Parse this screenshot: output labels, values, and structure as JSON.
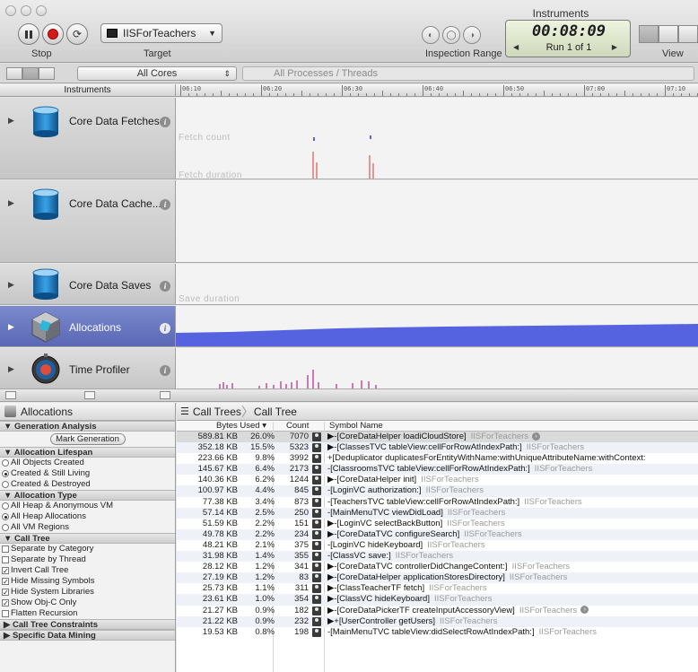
{
  "window": {
    "title": "Instruments"
  },
  "toolbar": {
    "stop_label": "Stop",
    "target_label": "Target",
    "target_name": "IISForTeachers",
    "inspection_label": "Inspection Range",
    "time": "00:08:09",
    "run": "Run 1 of 1",
    "view_label": "View"
  },
  "filterbar": {
    "cores": "All Cores",
    "processes": "All Processes / Threads"
  },
  "timeline": {
    "header": "Instruments",
    "ticks": [
      "06:10",
      "06:20",
      "06:30",
      "06:40",
      "06:50",
      "07:00",
      "07:10"
    ]
  },
  "instruments": [
    {
      "name": "Core Data Fetches",
      "track_labels": [
        "Fetch count",
        "Fetch duration"
      ]
    },
    {
      "name": "Core Data Cache...",
      "track_labels": []
    },
    {
      "name": "Core Data Saves",
      "track_labels": [
        "Save duration"
      ]
    },
    {
      "name": "Allocations",
      "track_labels": []
    },
    {
      "name": "Time Profiler",
      "track_labels": []
    }
  ],
  "detail": {
    "title": "Allocations",
    "sections": {
      "generation": "Generation Analysis",
      "mark_button": "Mark Generation",
      "lifespan": "Allocation Lifespan",
      "lifespan_options": [
        "All Objects Created",
        "Created & Still Living",
        "Created & Destroyed"
      ],
      "type": "Allocation Type",
      "type_options": [
        "All Heap & Anonymous VM",
        "All Heap Allocations",
        "All VM Regions"
      ],
      "calltree": "Call Tree",
      "calltree_options": [
        "Separate by Category",
        "Separate by Thread",
        "Invert Call Tree",
        "Hide Missing Symbols",
        "Hide System Libraries",
        "Show Obj-C Only",
        "Flatten Recursion"
      ],
      "constraints": "Call Tree Constraints",
      "mining": "Specific Data Mining"
    },
    "breadcrumbs": [
      "Call Trees",
      "Call Tree"
    ],
    "columns": {
      "bytes": "Bytes Used",
      "count": "Count",
      "symbol": "Symbol Name"
    },
    "library": "IISForTeachers",
    "rows": [
      {
        "bytes": "589.81 KB",
        "pct": "26.0%",
        "count": "7070",
        "symbol": "▶-[CoreDataHelper loadiCloudStore]",
        "lib": true
      },
      {
        "bytes": "352.18 KB",
        "pct": "15.5%",
        "count": "5323",
        "symbol": "▶-[ClassesTVC tableView:cellForRowAtIndexPath:]",
        "lib": true
      },
      {
        "bytes": "223.66 KB",
        "pct": "9.8%",
        "count": "3992",
        "symbol": "+[Deduplicator duplicatesForEntityWithName:withUniqueAttributeName:withContext:",
        "lib": false
      },
      {
        "bytes": "145.67 KB",
        "pct": "6.4%",
        "count": "2173",
        "symbol": "-[ClassroomsTVC tableView:cellForRowAtIndexPath:]",
        "lib": true
      },
      {
        "bytes": "140.36 KB",
        "pct": "6.2%",
        "count": "1244",
        "symbol": "▶-[CoreDataHelper init]",
        "lib": true
      },
      {
        "bytes": "100.97 KB",
        "pct": "4.4%",
        "count": "845",
        "symbol": "-[LoginVC authorization:]",
        "lib": true
      },
      {
        "bytes": "77.38 KB",
        "pct": "3.4%",
        "count": "873",
        "symbol": "-[TeachersTVC tableView:cellForRowAtIndexPath:]",
        "lib": true
      },
      {
        "bytes": "57.14 KB",
        "pct": "2.5%",
        "count": "250",
        "symbol": "-[MainMenuTVC viewDidLoad]",
        "lib": true
      },
      {
        "bytes": "51.59 KB",
        "pct": "2.2%",
        "count": "151",
        "symbol": "▶-[LoginVC selectBackButton]",
        "lib": true
      },
      {
        "bytes": "49.78 KB",
        "pct": "2.2%",
        "count": "234",
        "symbol": "▶-[CoreDataTVC configureSearch]",
        "lib": true
      },
      {
        "bytes": "48.21 KB",
        "pct": "2.1%",
        "count": "375",
        "symbol": "-[LoginVC hideKeyboard]",
        "lib": true
      },
      {
        "bytes": "31.98 KB",
        "pct": "1.4%",
        "count": "355",
        "symbol": "-[ClassVC save:]",
        "lib": true
      },
      {
        "bytes": "28.12 KB",
        "pct": "1.2%",
        "count": "341",
        "symbol": "▶-[CoreDataTVC controllerDidChangeContent:]",
        "lib": true
      },
      {
        "bytes": "27.19 KB",
        "pct": "1.2%",
        "count": "83",
        "symbol": "▶-[CoreDataHelper applicationStoresDirectory]",
        "lib": true
      },
      {
        "bytes": "25.73 KB",
        "pct": "1.1%",
        "count": "311",
        "symbol": "▶-[ClassTeacherTF fetch]",
        "lib": true
      },
      {
        "bytes": "23.61 KB",
        "pct": "1.0%",
        "count": "354",
        "symbol": "▶-[ClassVC hideKeyboard]",
        "lib": true
      },
      {
        "bytes": "21.27 KB",
        "pct": "0.9%",
        "count": "182",
        "symbol": "▶-[CoreDataPickerTF createInputAccessoryView]",
        "lib": true
      },
      {
        "bytes": "21.22 KB",
        "pct": "0.9%",
        "count": "232",
        "symbol": "▶+[UserController getUsers]",
        "lib": true
      },
      {
        "bytes": "19.53 KB",
        "pct": "0.8%",
        "count": "198",
        "symbol": "-[MainMenuTVC tableView:didSelectRowAtIndexPath:]",
        "lib": true
      }
    ]
  }
}
